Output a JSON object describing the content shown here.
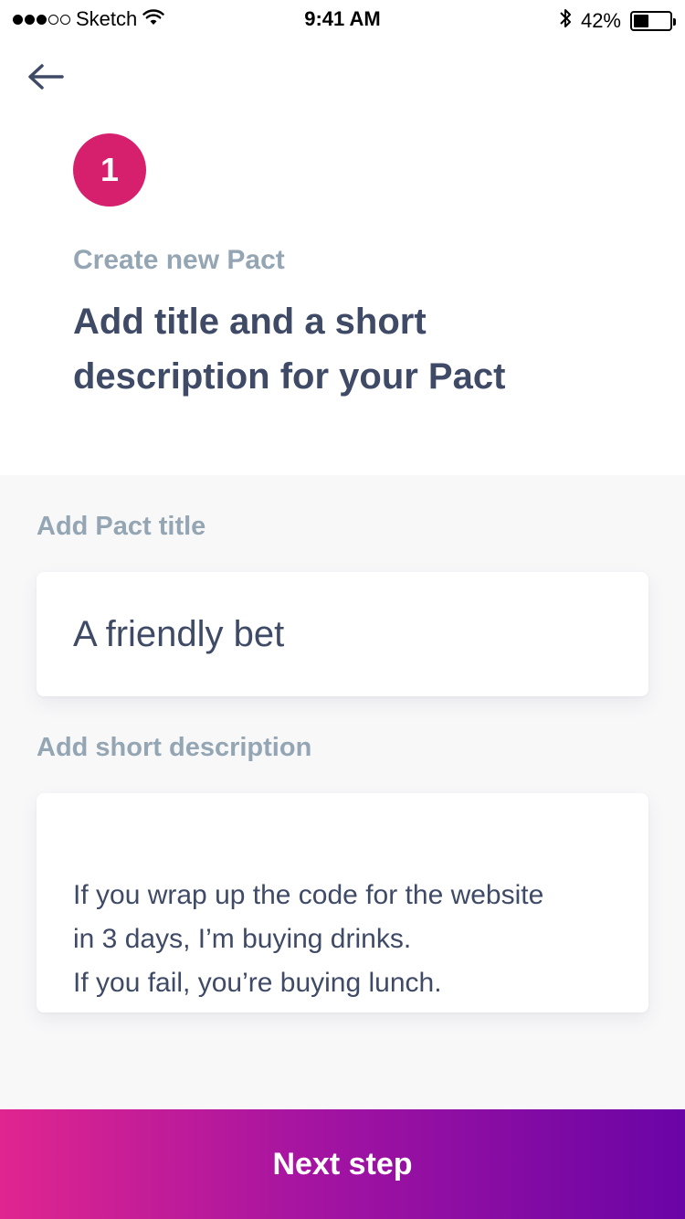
{
  "status_bar": {
    "carrier": "Sketch",
    "time": "9:41 AM",
    "battery_percent": "42%",
    "battery_level": 0.42,
    "signal_bars_filled": 3,
    "signal_bars_total": 5,
    "icons": [
      "wifi-icon",
      "bluetooth-icon",
      "battery-icon"
    ]
  },
  "header": {
    "back_icon": "arrow-left-icon",
    "step_number": "1",
    "subtitle": "Create new Pact",
    "headline": "Add title and a short description for your Pact"
  },
  "form": {
    "title_label": "Add Pact title",
    "title_value": "A friendly bet",
    "description_label": "Add short description",
    "description_value": "If you wrap up the code for the website\nin 3 days, I’m buying drinks.\nIf you fail, you’re buying lunch."
  },
  "footer": {
    "next_label": "Next step"
  },
  "colors": {
    "accent": "#d6206e",
    "gradient_start": "#e0258f",
    "gradient_end": "#6a04a6",
    "heading": "#3e4a66",
    "muted": "#94a5b4",
    "form_background": "#f8f8f9"
  }
}
